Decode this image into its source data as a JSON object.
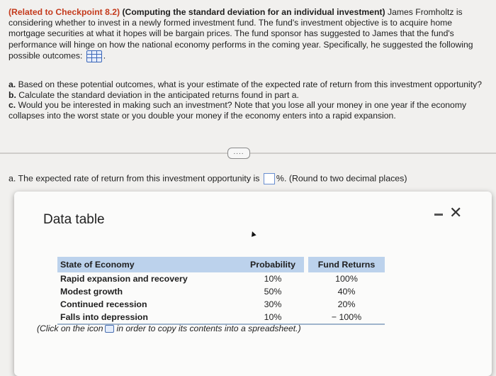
{
  "problem": {
    "ref": "(Related to Checkpoint 8.2)",
    "title": "(Computing the standard deviation for an individual investment)",
    "intro": "James Fromholtz is considering whether to invest in a newly formed investment fund. The fund's investment objective is to acquire home mortgage securities at what it hopes will be bargain prices. The fund sponsor has suggested to James that the fund's performance will hinge on how the national economy performs in the coming year. Specifically, he suggested the following possible outcomes:",
    "data_icon": "grid-table-icon",
    "after_icon": "."
  },
  "parts": [
    {
      "label": "a.",
      "text": "Based on these potential outcomes, what is your estimate of the expected rate of return from this investment opportunity?"
    },
    {
      "label": "b.",
      "text": "Calculate the standard deviation in the anticipated returns found in part a."
    },
    {
      "label": "c.",
      "text": "Would you be interested in making such an investment? Note that you lose all your money in one year if the economy collapses into the worst state or you double your money if the economy enters into a rapid expansion."
    }
  ],
  "more_button": "....",
  "answer": {
    "prefix": "a. The expected rate of return from this investment opportunity is",
    "value": "",
    "suffix": "%. (Round to two decimal places)"
  },
  "modal": {
    "title": "Data table",
    "minimize_icon": "minimize-icon",
    "close": "✕",
    "table": {
      "headers": [
        "State of Economy",
        "Probability",
        "Fund Returns"
      ],
      "rows": [
        [
          "Rapid expansion and recovery",
          "10%",
          "100%"
        ],
        [
          "Modest growth",
          "50%",
          "40%"
        ],
        [
          "Continued recession",
          "30%",
          "20%"
        ],
        [
          "Falls into depression",
          "10%",
          "− 100%"
        ]
      ]
    },
    "copy_note_before": "(Click on the icon",
    "copy_note_after": "in order to copy its contents into a spreadsheet.)"
  }
}
